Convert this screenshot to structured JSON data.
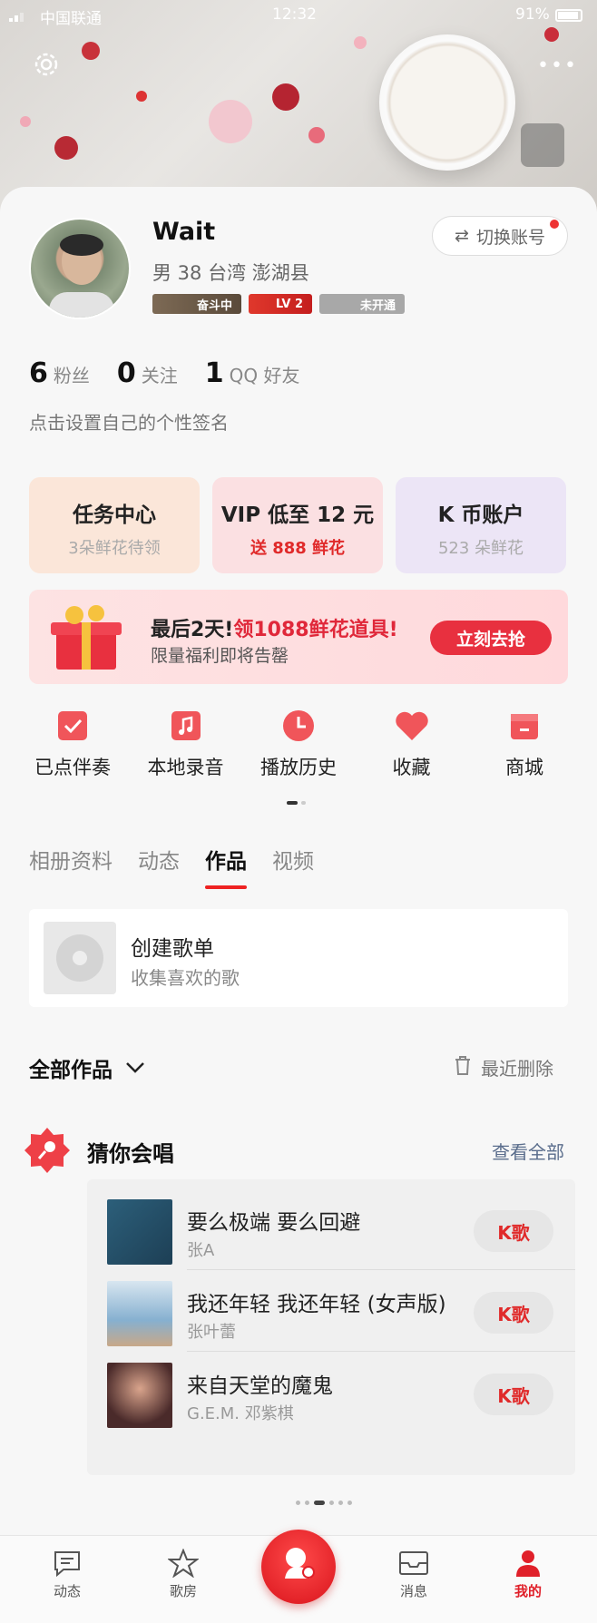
{
  "status_bar": {
    "carrier": "中国联通",
    "time": "12:32",
    "battery": "91%"
  },
  "profile": {
    "name": "Wait",
    "info": "男 38   台湾 澎湖县",
    "badges": [
      "奋斗中",
      "LV 2",
      "未开通"
    ],
    "switch_account": "切换账号",
    "stats": [
      {
        "num": "6",
        "label": "粉丝"
      },
      {
        "num": "0",
        "label": "关注"
      },
      {
        "num": "1",
        "label": "QQ 好友"
      }
    ],
    "signature": "点击设置自己的个性签名"
  },
  "feature_cards": [
    {
      "title": "任务中心",
      "sub": "3朵鲜花待领"
    },
    {
      "title": "VIP 低至 12 元",
      "sub": "送 888 鲜花"
    },
    {
      "title": "K 币账户",
      "sub": "523 朵鲜花"
    }
  ],
  "promo": {
    "line1_prefix": "最后2天!",
    "line1_highlight": "领1088鲜花道具!",
    "line2": "限量福利即将告罄",
    "button": "立刻去抢"
  },
  "quick_menu": [
    {
      "label": "已点伴奏",
      "icon": "check-box-icon"
    },
    {
      "label": "本地录音",
      "icon": "music-note-icon"
    },
    {
      "label": "播放历史",
      "icon": "clock-icon"
    },
    {
      "label": "收藏",
      "icon": "heart-icon"
    },
    {
      "label": "商城",
      "icon": "shop-icon"
    }
  ],
  "tabs": [
    "相册资料",
    "动态",
    "作品",
    "视频"
  ],
  "active_tab": "作品",
  "create_playlist": {
    "title": "创建歌单",
    "subtitle": "收集喜欢的歌"
  },
  "works": {
    "all_label": "全部作品",
    "recent_deleted": "最近删除"
  },
  "guess": {
    "title": "猜你会唱",
    "see_all": "查看全部",
    "songs": [
      {
        "name": "要么极端 要么回避",
        "artist": "张A",
        "button": "K歌"
      },
      {
        "name": "我还年轻 我还年轻 (女声版)",
        "artist": "张叶蕾",
        "button": "K歌"
      },
      {
        "name": "来自天堂的魔鬼",
        "artist": "G.E.M. 邓紫棋",
        "button": "K歌"
      }
    ]
  },
  "bottom_nav": [
    {
      "label": "动态",
      "icon": "feed-icon"
    },
    {
      "label": "歌房",
      "icon": "star-icon"
    },
    {
      "label": "消息",
      "icon": "mail-icon"
    },
    {
      "label": "我的",
      "icon": "person-icon"
    }
  ],
  "colors": {
    "accent": "#e0202a",
    "link": "#5a6d8c"
  }
}
